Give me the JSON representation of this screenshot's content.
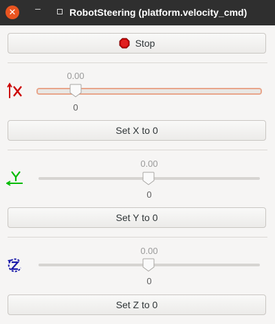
{
  "window": {
    "title": "RobotSteering (platform.velocity_cmd)",
    "close_glyph": "✕",
    "minimize_glyph": "–"
  },
  "stop_button": {
    "label": "Stop",
    "icon": "stop-octagon-icon",
    "icon_color": "#cc0000"
  },
  "axes": [
    {
      "id": "x",
      "icon": "arrow-up-x-icon",
      "color": "#cc0000",
      "value_label": "0.00",
      "tick_label": "0",
      "position": 0.15,
      "focused": true,
      "reset_label": "Set X to 0"
    },
    {
      "id": "y",
      "icon": "arrow-left-y-icon",
      "color": "#00bb00",
      "value_label": "0.00",
      "tick_label": "0",
      "position": 0.5,
      "focused": false,
      "reset_label": "Set Y to 0"
    },
    {
      "id": "z",
      "icon": "rotate-z-icon",
      "color": "#1a1aaa",
      "value_label": "0.00",
      "tick_label": "0",
      "position": 0.5,
      "focused": false,
      "reset_label": "Set Z to 0"
    }
  ]
}
